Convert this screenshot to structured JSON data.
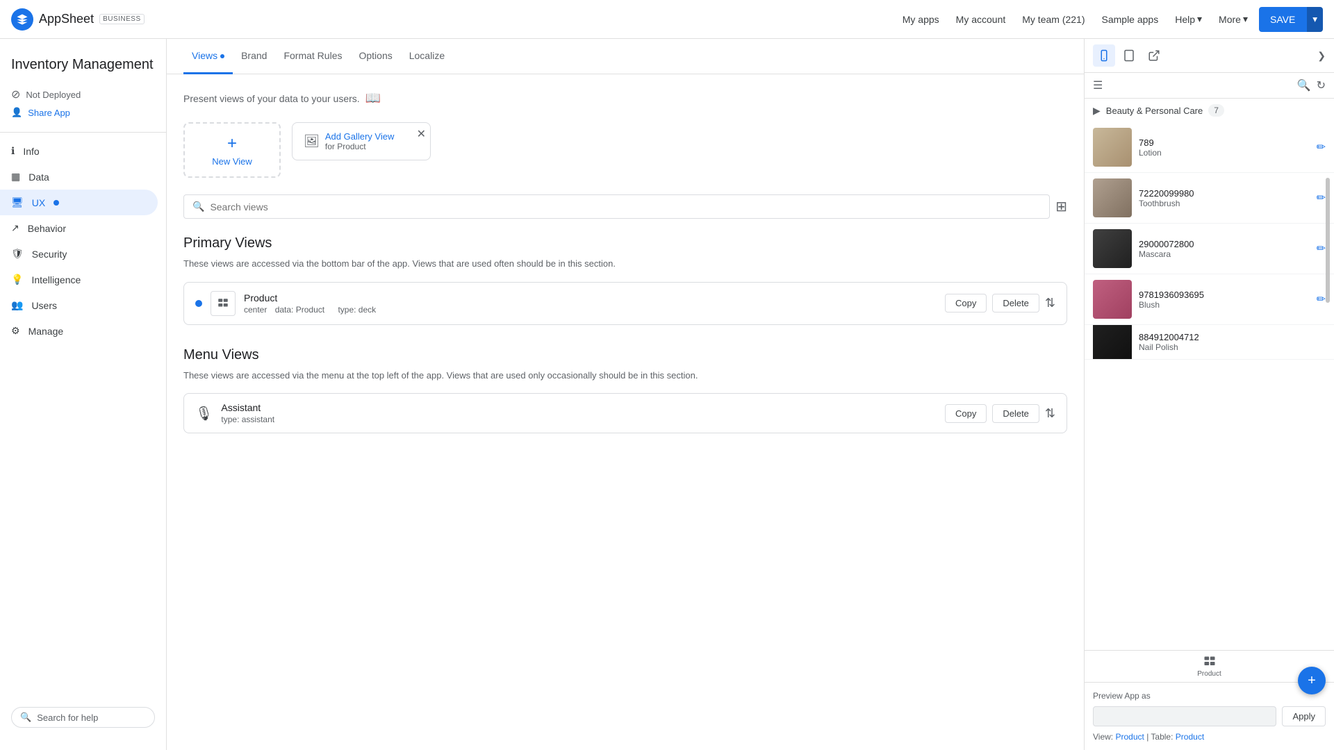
{
  "app": {
    "name": "AppSheet",
    "badge": "BUSINESS",
    "title": "Inventory Management",
    "status": "Not Deployed",
    "share": "Share App"
  },
  "topnav": {
    "links": [
      "My apps",
      "My account",
      "My team (221)",
      "Sample apps"
    ],
    "help": "Help",
    "more": "More",
    "save": "SAVE"
  },
  "sidebar": {
    "nav": [
      {
        "label": "Info",
        "icon": "info-icon"
      },
      {
        "label": "Data",
        "icon": "data-icon"
      },
      {
        "label": "UX",
        "icon": "ux-icon",
        "active": true,
        "dot": true
      },
      {
        "label": "Behavior",
        "icon": "behavior-icon"
      },
      {
        "label": "Security",
        "icon": "security-icon"
      },
      {
        "label": "Intelligence",
        "icon": "intelligence-icon"
      },
      {
        "label": "Users",
        "icon": "users-icon"
      },
      {
        "label": "Manage",
        "icon": "manage-icon"
      }
    ],
    "search_placeholder": "Search for help"
  },
  "tabs": [
    {
      "label": "Views",
      "active": true,
      "dot": true
    },
    {
      "label": "Brand"
    },
    {
      "label": "Format Rules"
    },
    {
      "label": "Options"
    },
    {
      "label": "Localize"
    }
  ],
  "content": {
    "description": "Present views of your data to your users.",
    "new_view_label": "New View",
    "add_gallery_label": "Add Gallery View",
    "add_gallery_sub": "for Product",
    "search_placeholder": "Search views",
    "primary_views_title": "Primary Views",
    "primary_views_desc": "These views are accessed via the bottom bar of the app. Views that are used often should be in this section.",
    "menu_views_title": "Menu Views",
    "menu_views_desc": "These views are accessed via the menu at the top left of the app. Views that are used only occasionally should be in this section.",
    "views": [
      {
        "name": "Product",
        "center": "center",
        "data": "Product",
        "type": "deck",
        "section": "primary"
      }
    ],
    "menu_views": [
      {
        "name": "Assistant",
        "type": "assistant",
        "section": "menu"
      }
    ],
    "copy_label": "Copy",
    "delete_label": "Delete"
  },
  "preview": {
    "collapse_tooltip": "Collapse",
    "section_label": "Beauty & Personal Care",
    "section_count": "7",
    "items": [
      {
        "id": "789",
        "name": "Lotion",
        "img_class": "img-lotion"
      },
      {
        "id": "72220099980",
        "name": "Toothbrush",
        "img_class": "img-toothbrush"
      },
      {
        "id": "29000072800",
        "name": "Mascara",
        "img_class": "img-mascara"
      },
      {
        "id": "9781936093695",
        "name": "Blush",
        "img_class": "img-blush"
      },
      {
        "id": "884912004712",
        "name": "Nail Polish",
        "img_class": "img-nailpolish"
      }
    ],
    "preview_as_label": "Preview App as",
    "apply_label": "Apply",
    "view_label": "View:",
    "view_value": "Product",
    "table_label": "Table:",
    "table_value": "Product"
  }
}
